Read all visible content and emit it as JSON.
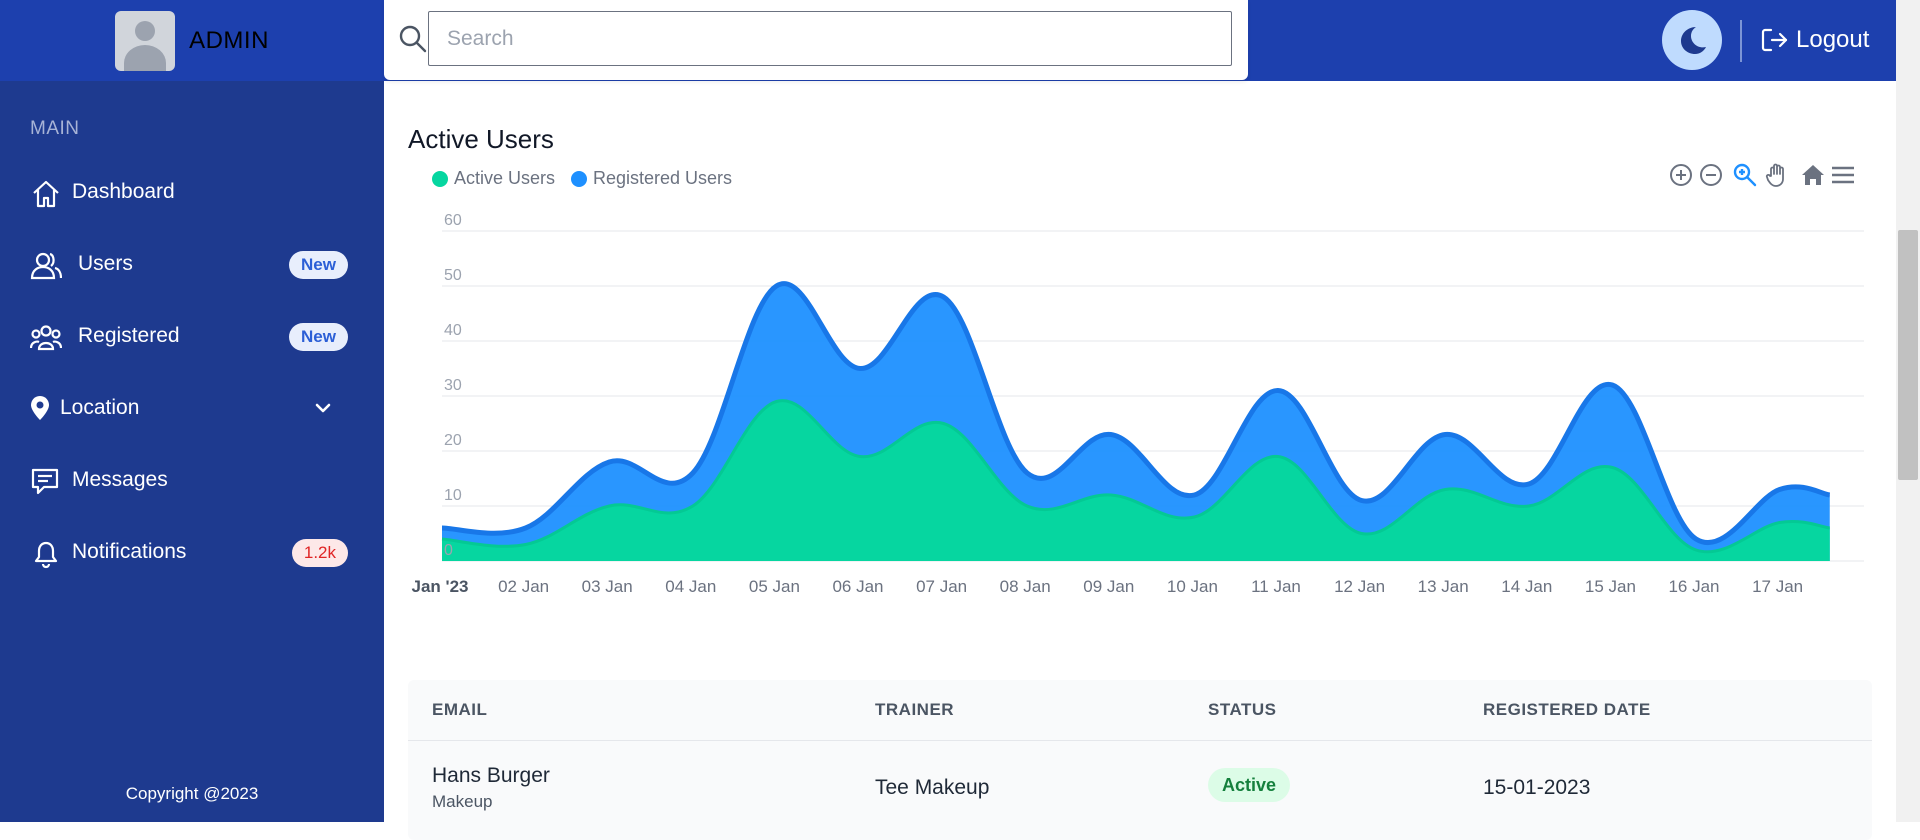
{
  "brand": {
    "name": "ADMIN"
  },
  "search": {
    "placeholder": "Search"
  },
  "header": {
    "logout_label": "Logout"
  },
  "sidebar": {
    "section_label": "MAIN",
    "items": [
      {
        "label": "Dashboard",
        "icon": "home-icon"
      },
      {
        "label": "Users",
        "icon": "users-icon",
        "badge": "New"
      },
      {
        "label": "Registered",
        "icon": "group-icon",
        "badge": "New"
      },
      {
        "label": "Location",
        "icon": "location-pin-icon"
      },
      {
        "label": "Messages",
        "icon": "message-icon"
      },
      {
        "label": "Notifications",
        "icon": "bell-icon",
        "badge": "1.2k"
      }
    ],
    "copyright": "Copyright @2023"
  },
  "chart": {
    "title": "Active Users",
    "legend": [
      "Active Users",
      "Registered Users"
    ]
  },
  "chart_data": {
    "type": "area",
    "title": "Active Users",
    "categories": [
      "Jan '23",
      "02 Jan",
      "03 Jan",
      "04 Jan",
      "05 Jan",
      "06 Jan",
      "07 Jan",
      "08 Jan",
      "09 Jan",
      "10 Jan",
      "11 Jan",
      "12 Jan",
      "13 Jan",
      "14 Jan",
      "15 Jan",
      "16 Jan",
      "17 Jan"
    ],
    "series": [
      {
        "name": "Active Users",
        "values": [
          4,
          3,
          10,
          10,
          29,
          19,
          25,
          10,
          12,
          8,
          19,
          5,
          13,
          10,
          17,
          2,
          7
        ],
        "color": "#06d6a0"
      },
      {
        "name": "Registered Users",
        "values": [
          2,
          3,
          8,
          6,
          21,
          16,
          23,
          6,
          11,
          4,
          12,
          6,
          10,
          4,
          15,
          2,
          6
        ],
        "color": "#1e90ff"
      }
    ],
    "stacked": true,
    "yticks": [
      0,
      10,
      20,
      30,
      40,
      50,
      60
    ],
    "ylim": [
      0,
      60
    ],
    "grid": true,
    "legend_position": "top-left"
  },
  "table": {
    "headers": [
      "EMAIL",
      "TRAINER",
      "STATUS",
      "REGISTERED DATE"
    ],
    "rows": [
      {
        "name": "Hans Burger",
        "sub": "Makeup",
        "trainer": "Tee Makeup",
        "status": "Active",
        "date": "15-01-2023"
      }
    ]
  }
}
